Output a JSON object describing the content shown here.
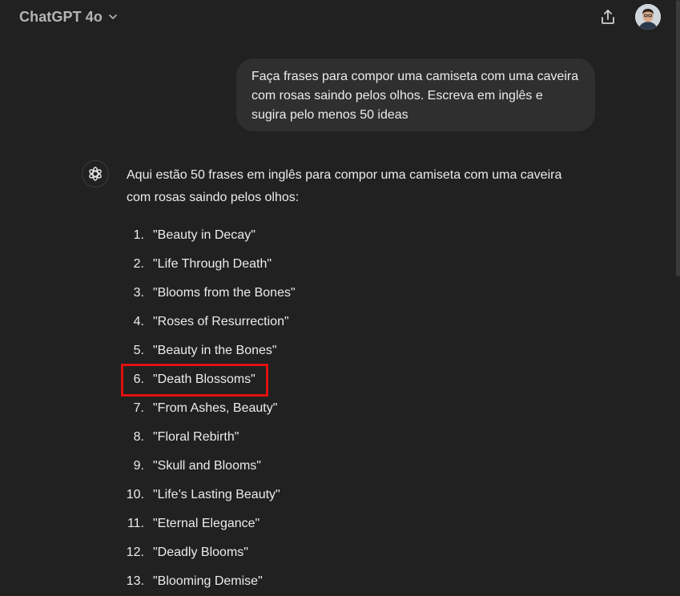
{
  "header": {
    "model_name": "ChatGPT 4o"
  },
  "conversation": {
    "user_message": "Faça frases para compor uma camiseta com uma caveira com rosas saindo pelos olhos. Escreva em inglês e sugira pelo menos 50 ideas",
    "assistant_intro": "Aqui estão 50 frases em inglês para compor uma camiseta com uma caveira com rosas saindo pelos olhos:",
    "phrases": [
      {
        "num": "1.",
        "text": "\"Beauty in Decay\""
      },
      {
        "num": "2.",
        "text": "\"Life Through Death\""
      },
      {
        "num": "3.",
        "text": "\"Blooms from the Bones\""
      },
      {
        "num": "4.",
        "text": "\"Roses of Resurrection\""
      },
      {
        "num": "5.",
        "text": "\"Beauty in the Bones\""
      },
      {
        "num": "6.",
        "text": "\"Death Blossoms\""
      },
      {
        "num": "7.",
        "text": "\"From Ashes, Beauty\""
      },
      {
        "num": "8.",
        "text": "\"Floral Rebirth\""
      },
      {
        "num": "9.",
        "text": "\"Skull and Blooms\""
      },
      {
        "num": "10.",
        "text": "\"Life’s Lasting Beauty\""
      },
      {
        "num": "11.",
        "text": "\"Eternal Elegance\""
      },
      {
        "num": "12.",
        "text": "\"Deadly Blooms\""
      },
      {
        "num": "13.",
        "text": "\"Blooming Demise\""
      }
    ]
  },
  "icons": {
    "model_chevron": "chevron-down-icon",
    "share": "share-icon",
    "assistant": "openai-logo-icon",
    "user": "avatar"
  },
  "colors": {
    "background": "#212121",
    "user_bubble": "#2f2f2f",
    "text": "#ececec",
    "muted": "#b4b4b4",
    "highlight": "#e0100f"
  }
}
